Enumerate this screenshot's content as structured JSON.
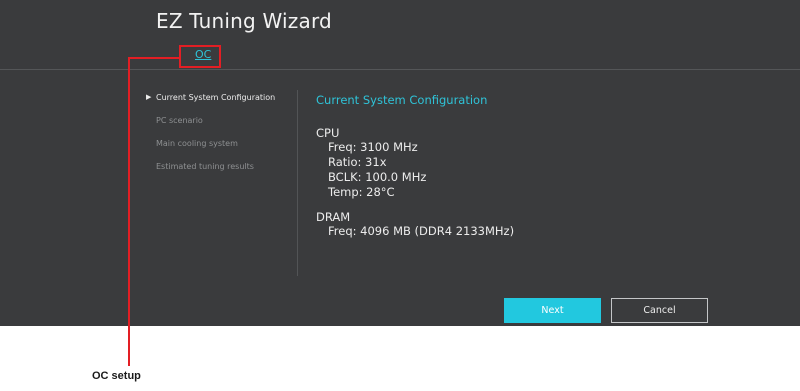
{
  "window": {
    "title": "EZ Tuning Wizard"
  },
  "tabs": [
    {
      "label": "OC",
      "active": true
    }
  ],
  "steps": [
    {
      "label": "Current System Configuration",
      "active": true
    },
    {
      "label": "PC scenario",
      "active": false
    },
    {
      "label": "Main cooling system",
      "active": false
    },
    {
      "label": "Estimated tuning results",
      "active": false
    }
  ],
  "content": {
    "heading": "Current System Configuration",
    "cpu": {
      "label": "CPU",
      "freq": "Freq: 3100 MHz",
      "ratio": "Ratio: 31x",
      "bclk": "BCLK: 100.0 MHz",
      "temp": "Temp: 28°C"
    },
    "dram": {
      "label": "DRAM",
      "freq": "Freq: 4096 MB (DDR4 2133MHz)"
    }
  },
  "buttons": {
    "next": "Next",
    "cancel": "Cancel"
  },
  "annotation": {
    "label": "OC setup"
  },
  "colors": {
    "panel_background": "#3a3b3d",
    "accent": "#22c8df",
    "callout": "#e31e24"
  },
  "icons": {
    "step_pointer": "triangle-right-icon"
  }
}
